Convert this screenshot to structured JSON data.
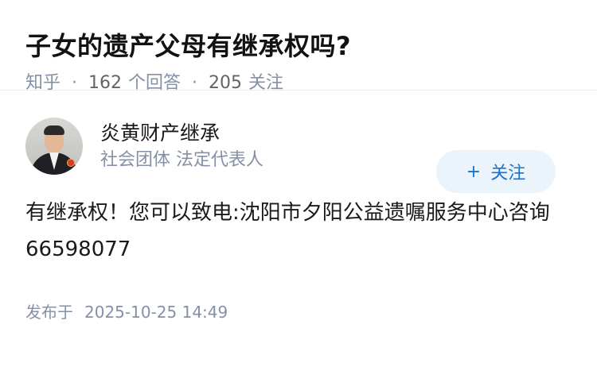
{
  "question": {
    "title": "子女的遗产父母有继承权吗?",
    "source": "知乎",
    "separator": "·",
    "answer_count": "162",
    "answer_label": "个回答",
    "follower_count": "205",
    "follower_label": "关注"
  },
  "answer": {
    "author": {
      "name": "炎黄财产继承",
      "headline": "社会团体 法定代表人",
      "follow_icon": "+",
      "follow_label": "关注"
    },
    "content": "有继承权！您可以致电:沈阳市夕阳公益遗嘱服务中心咨询66598077",
    "published_label": "发布于",
    "published_time": "2025-10-25 14:49"
  },
  "colors": {
    "accent": "#1772d1",
    "follow_bg": "#ebf3fb",
    "meta_gray": "#8590a6"
  }
}
